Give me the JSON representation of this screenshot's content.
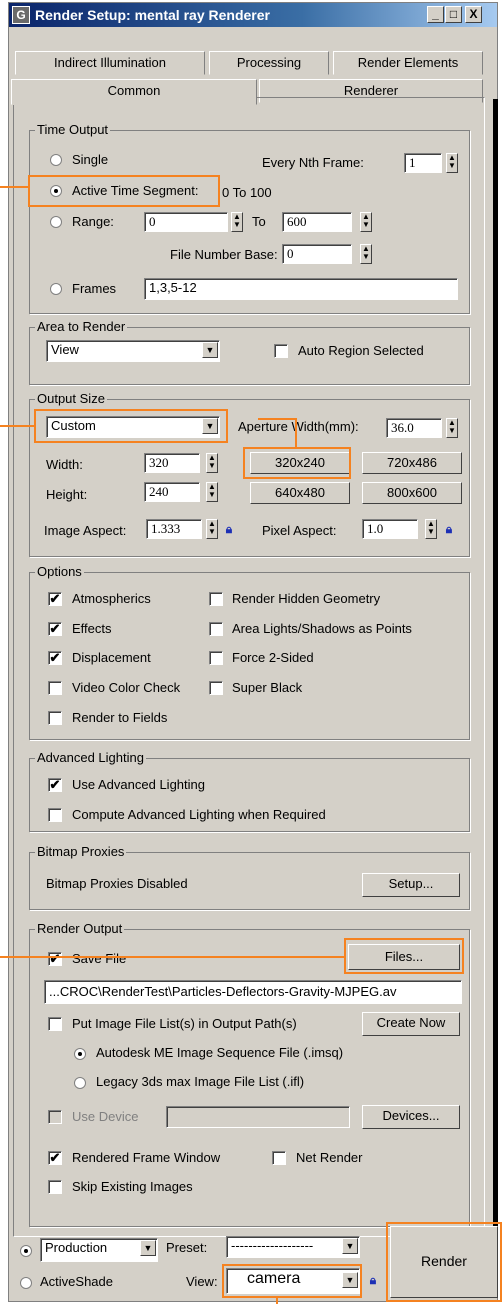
{
  "window": {
    "title": "Render Setup: mental ray Renderer",
    "minimize_label": "_",
    "maximize_label": "□",
    "close_label": "X"
  },
  "tabs": {
    "row1": [
      "Indirect Illumination",
      "Processing",
      "Render Elements"
    ],
    "row2": [
      "Common",
      "Renderer"
    ],
    "active": "Common"
  },
  "time_output": {
    "legend": "Time Output",
    "single_label": "Single",
    "every_nth_label": "Every Nth Frame:",
    "every_nth_value": "1",
    "active_segment_label": "Active Time Segment:",
    "active_segment_value": "0 To 100",
    "range_label": "Range:",
    "range_start": "0",
    "to_label": "To",
    "range_end": "600",
    "file_number_base_label": "File Number Base:",
    "file_number_base_value": "0",
    "frames_label": "Frames",
    "frames_value": "1,3,5-12",
    "selected": "active_segment"
  },
  "area_to_render": {
    "legend": "Area to Render",
    "value": "View",
    "auto_region_label": "Auto Region Selected",
    "auto_region_checked": false
  },
  "output_size": {
    "legend": "Output Size",
    "preset_value": "Custom",
    "aperture_label": "Aperture Width(mm):",
    "aperture_value": "36.0",
    "width_label": "Width:",
    "width_value": "320",
    "height_label": "Height:",
    "height_value": "240",
    "presets": [
      "320x240",
      "720x486",
      "640x480",
      "800x600"
    ],
    "image_aspect_label": "Image Aspect:",
    "image_aspect_value": "1.333",
    "pixel_aspect_label": "Pixel Aspect:",
    "pixel_aspect_value": "1.0"
  },
  "options": {
    "legend": "Options",
    "items": [
      {
        "label": "Atmospherics",
        "checked": true
      },
      {
        "label": "Render Hidden Geometry",
        "checked": false
      },
      {
        "label": "Effects",
        "checked": true
      },
      {
        "label": "Area Lights/Shadows as Points",
        "checked": false
      },
      {
        "label": "Displacement",
        "checked": true
      },
      {
        "label": "Force 2-Sided",
        "checked": false
      },
      {
        "label": "Video Color Check",
        "checked": false
      },
      {
        "label": "Super Black",
        "checked": false
      },
      {
        "label": "Render to Fields",
        "checked": false
      }
    ]
  },
  "advanced_lighting": {
    "legend": "Advanced Lighting",
    "items": [
      {
        "label": "Use Advanced Lighting",
        "checked": true
      },
      {
        "label": "Compute Advanced Lighting when Required",
        "checked": false
      }
    ]
  },
  "bitmap_proxies": {
    "legend": "Bitmap Proxies",
    "status": "Bitmap Proxies Disabled",
    "setup_label": "Setup..."
  },
  "render_output": {
    "legend": "Render Output",
    "save_file_label": "Save File",
    "save_file_checked": true,
    "files_label": "Files...",
    "path_value": "...CROC\\RenderTest\\Particles-Deflectors-Gravity-MJPEG.av",
    "put_list_label": "Put Image File List(s) in Output Path(s)",
    "put_list_checked": false,
    "create_now_label": "Create Now",
    "autodesk_label": "Autodesk ME Image Sequence File (.imsq)",
    "legacy_label": "Legacy 3ds max Image File List (.ifl)",
    "list_format_selected": "autodesk",
    "use_device_label": "Use Device",
    "devices_label": "Devices...",
    "rendered_frame_label": "Rendered Frame Window",
    "rendered_frame_checked": true,
    "net_render_label": "Net Render",
    "net_render_checked": false,
    "skip_existing_label": "Skip Existing Images",
    "skip_existing_checked": false
  },
  "bottom": {
    "production_value": "Production",
    "activeshade_label": "ActiveShade",
    "mode_selected": "production",
    "preset_label": "Preset:",
    "preset_value": "-------------------",
    "view_label": "View:",
    "view_value": "camera",
    "render_label": "Render"
  },
  "accent_color": "#f58220",
  "check_mark": "✔"
}
